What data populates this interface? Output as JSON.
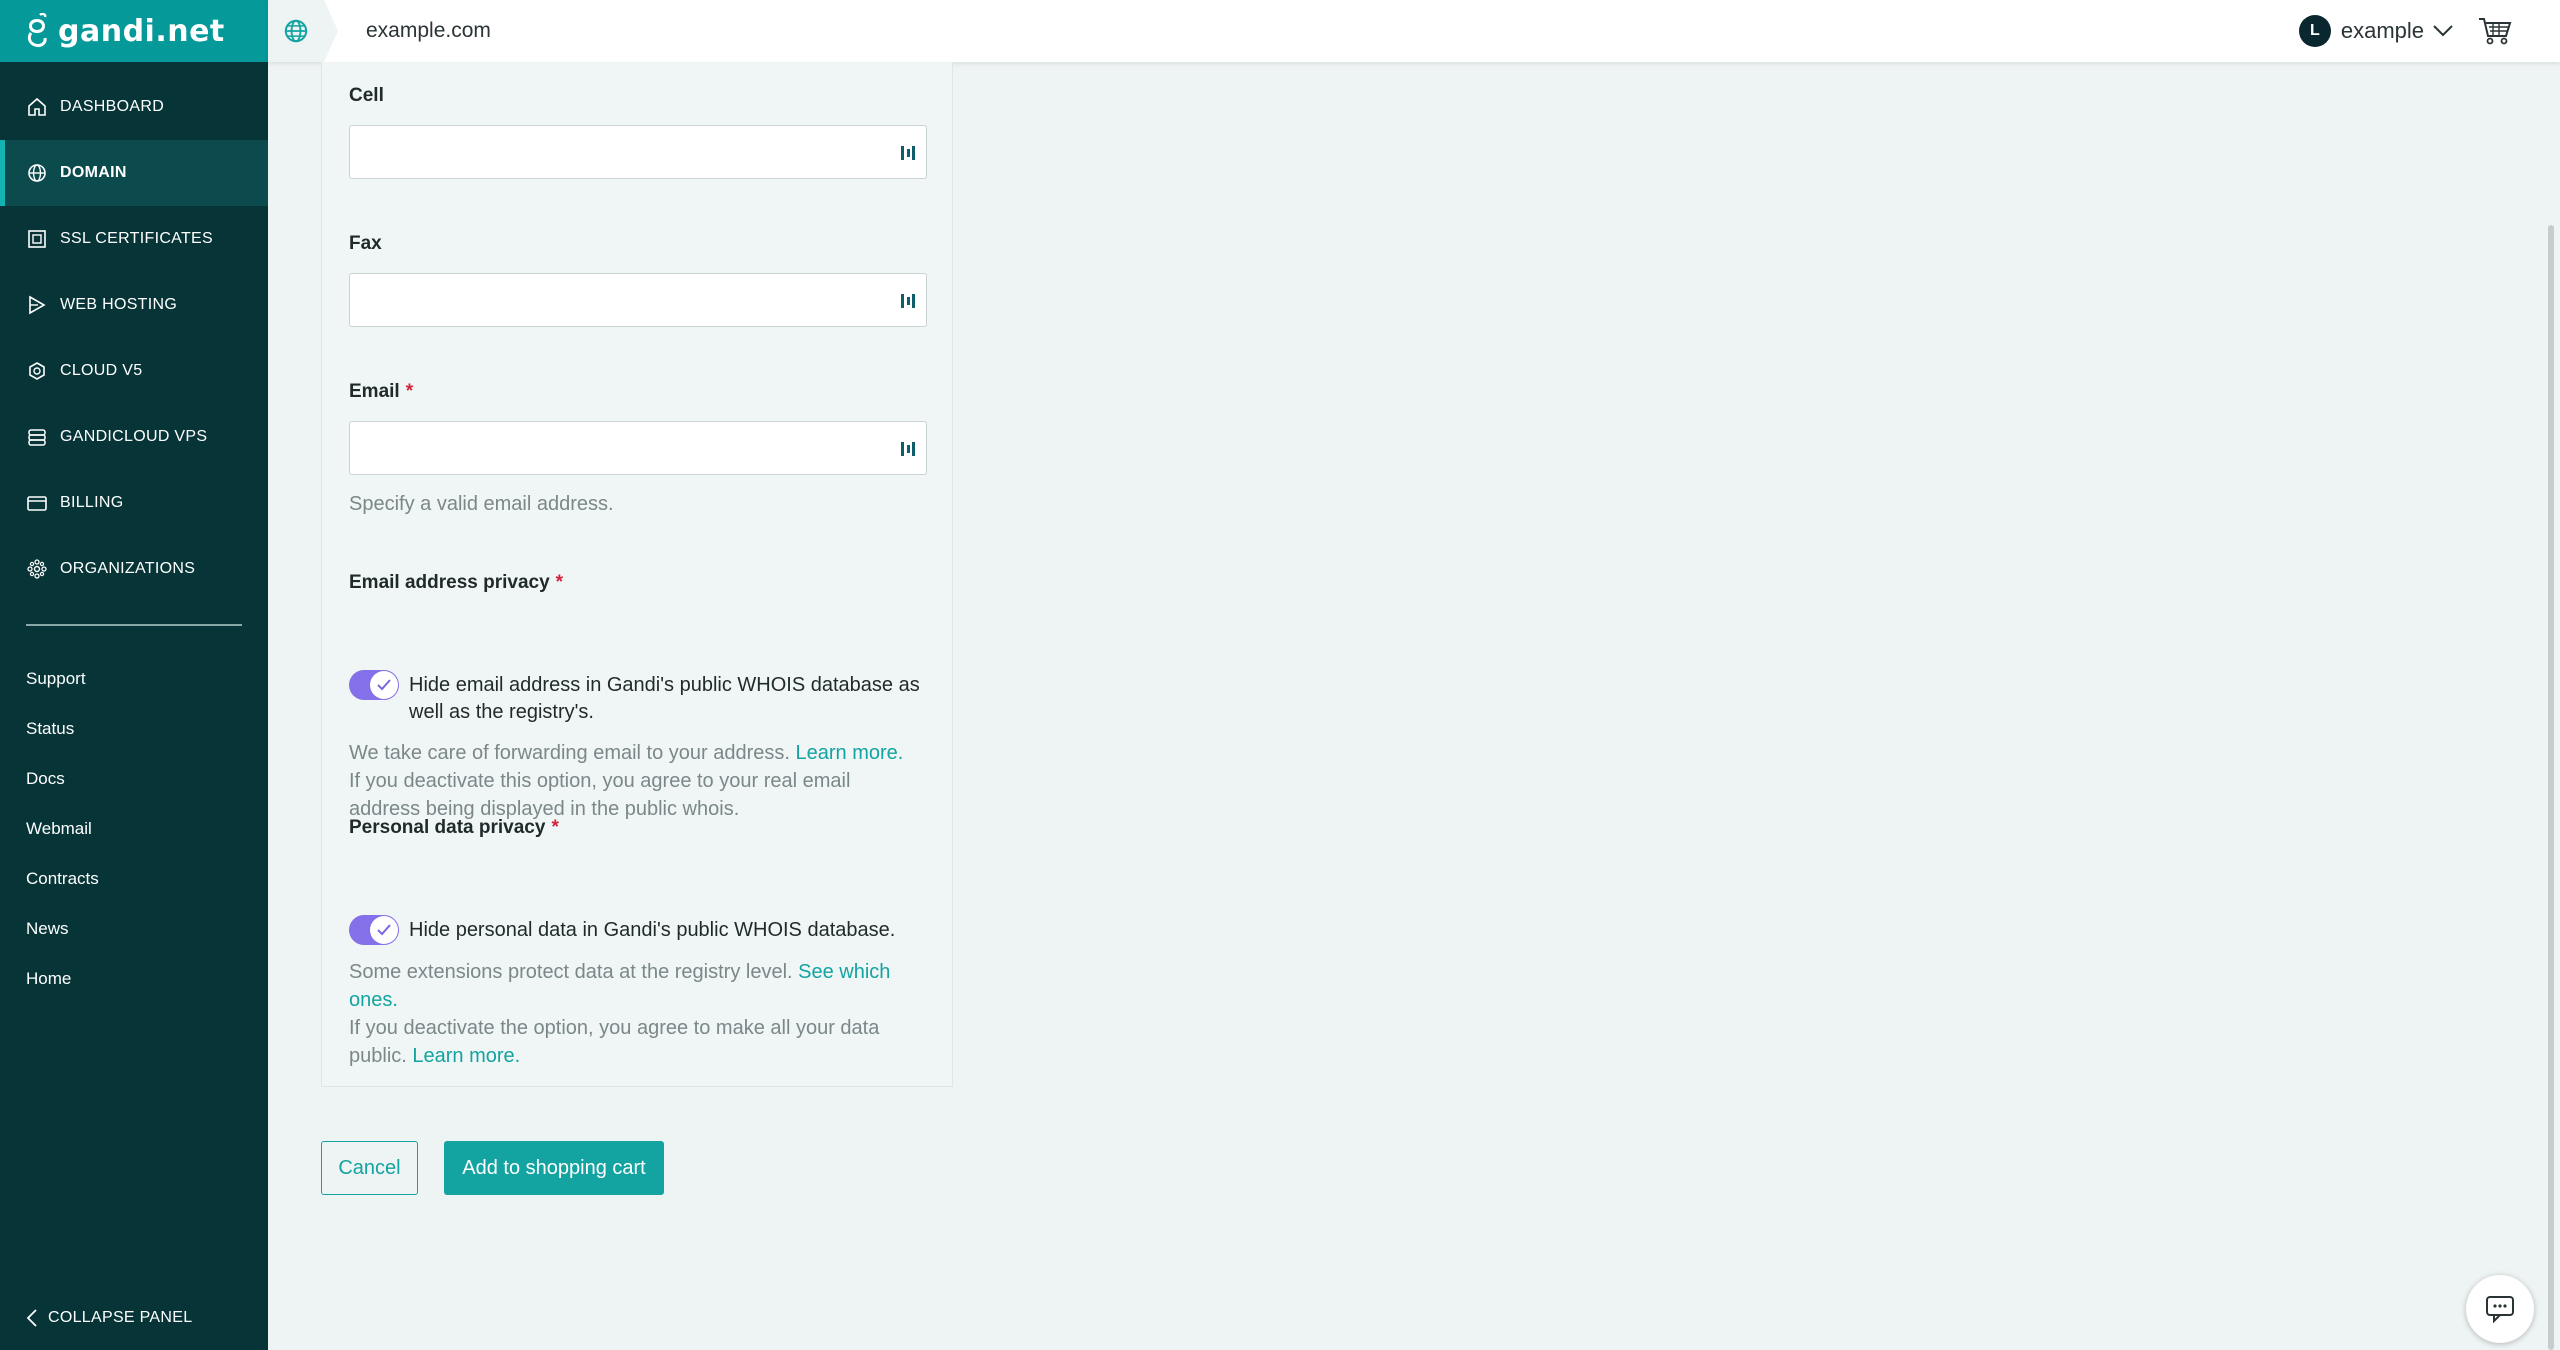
{
  "brand": {
    "name": "gandi.net"
  },
  "topbar": {
    "domain": "example.com",
    "avatar_initial": "L",
    "username": "example"
  },
  "sidebar": {
    "items": [
      {
        "label": "DASHBOARD",
        "icon": "home-icon"
      },
      {
        "label": "DOMAIN",
        "icon": "globe-icon",
        "active": true
      },
      {
        "label": "SSL CERTIFICATES",
        "icon": "certificate-icon"
      },
      {
        "label": "WEB HOSTING",
        "icon": "hosting-icon"
      },
      {
        "label": "CLOUD V5",
        "icon": "cloud-icon"
      },
      {
        "label": "GANDICLOUD VPS",
        "icon": "server-icon"
      },
      {
        "label": "BILLING",
        "icon": "credit-card-icon"
      },
      {
        "label": "ORGANIZATIONS",
        "icon": "organizations-icon"
      }
    ],
    "links": [
      "Support",
      "Status",
      "Docs",
      "Webmail",
      "Contracts",
      "News",
      "Home"
    ],
    "collapse_label": "COLLAPSE PANEL"
  },
  "form": {
    "cell": {
      "label": "Cell",
      "value": ""
    },
    "fax": {
      "label": "Fax",
      "value": ""
    },
    "email": {
      "label": "Email",
      "required_mark": "*",
      "value": "",
      "help": "Specify a valid email address."
    },
    "email_privacy": {
      "label": "Email address privacy",
      "required_mark": "*",
      "checked": true,
      "toggle_text": "Hide email address in Gandi's public WHOIS database as well as the registry's.",
      "help_1": "We take care of forwarding email to your address.",
      "help_link": "Learn more.",
      "help_2": "If you deactivate this option, you agree to your real email address being displayed in the public whois."
    },
    "personal_privacy": {
      "label": "Personal data privacy",
      "required_mark": "*",
      "checked": true,
      "toggle_text": "Hide personal data in Gandi's public WHOIS database.",
      "help_1": "Some extensions protect data at the registry level.",
      "help_link_1": "See which ones.",
      "help_2": "If you deactivate the option, you agree to make all your data public.",
      "help_link_2": "Learn more."
    }
  },
  "actions": {
    "cancel": "Cancel",
    "add_to_cart": "Add to shopping cart"
  },
  "colors": {
    "sidebar_bg": "#063437",
    "brand_teal": "#05999a",
    "accent": "#13a3a1",
    "toggle_on": "#8470e8",
    "required": "#d0243a"
  }
}
